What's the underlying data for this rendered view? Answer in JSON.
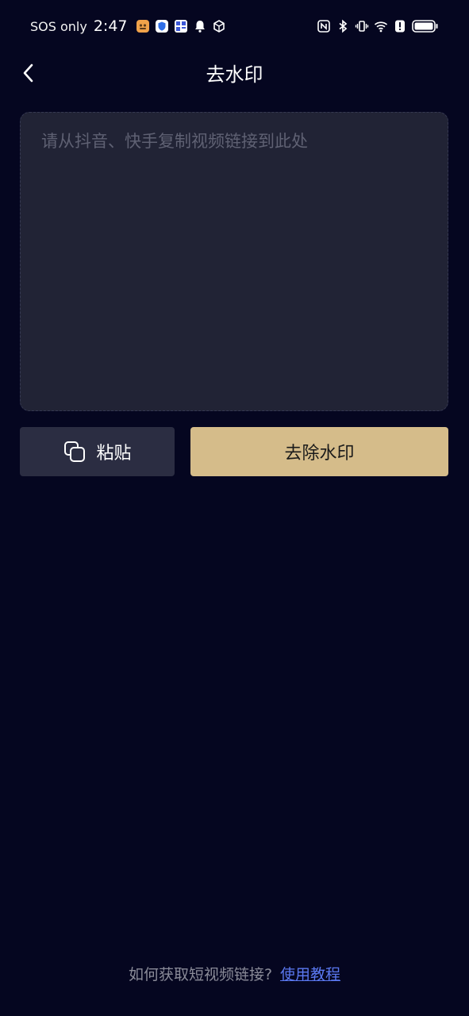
{
  "status_bar": {
    "carrier": "SOS only",
    "time": "2:47"
  },
  "header": {
    "title": "去水印"
  },
  "input": {
    "value": "",
    "placeholder": "请从抖音、快手复制视频链接到此处"
  },
  "actions": {
    "paste_label": "粘贴",
    "remove_label": "去除水印"
  },
  "footer": {
    "question": "如何获取短视频链接?",
    "link_label": "使用教程"
  },
  "colors": {
    "background": "#050620",
    "input_bg": "#212335",
    "paste_btn": "#2b2d42",
    "accent_gold": "#d5bc8a",
    "link_blue": "#5a78f0"
  }
}
